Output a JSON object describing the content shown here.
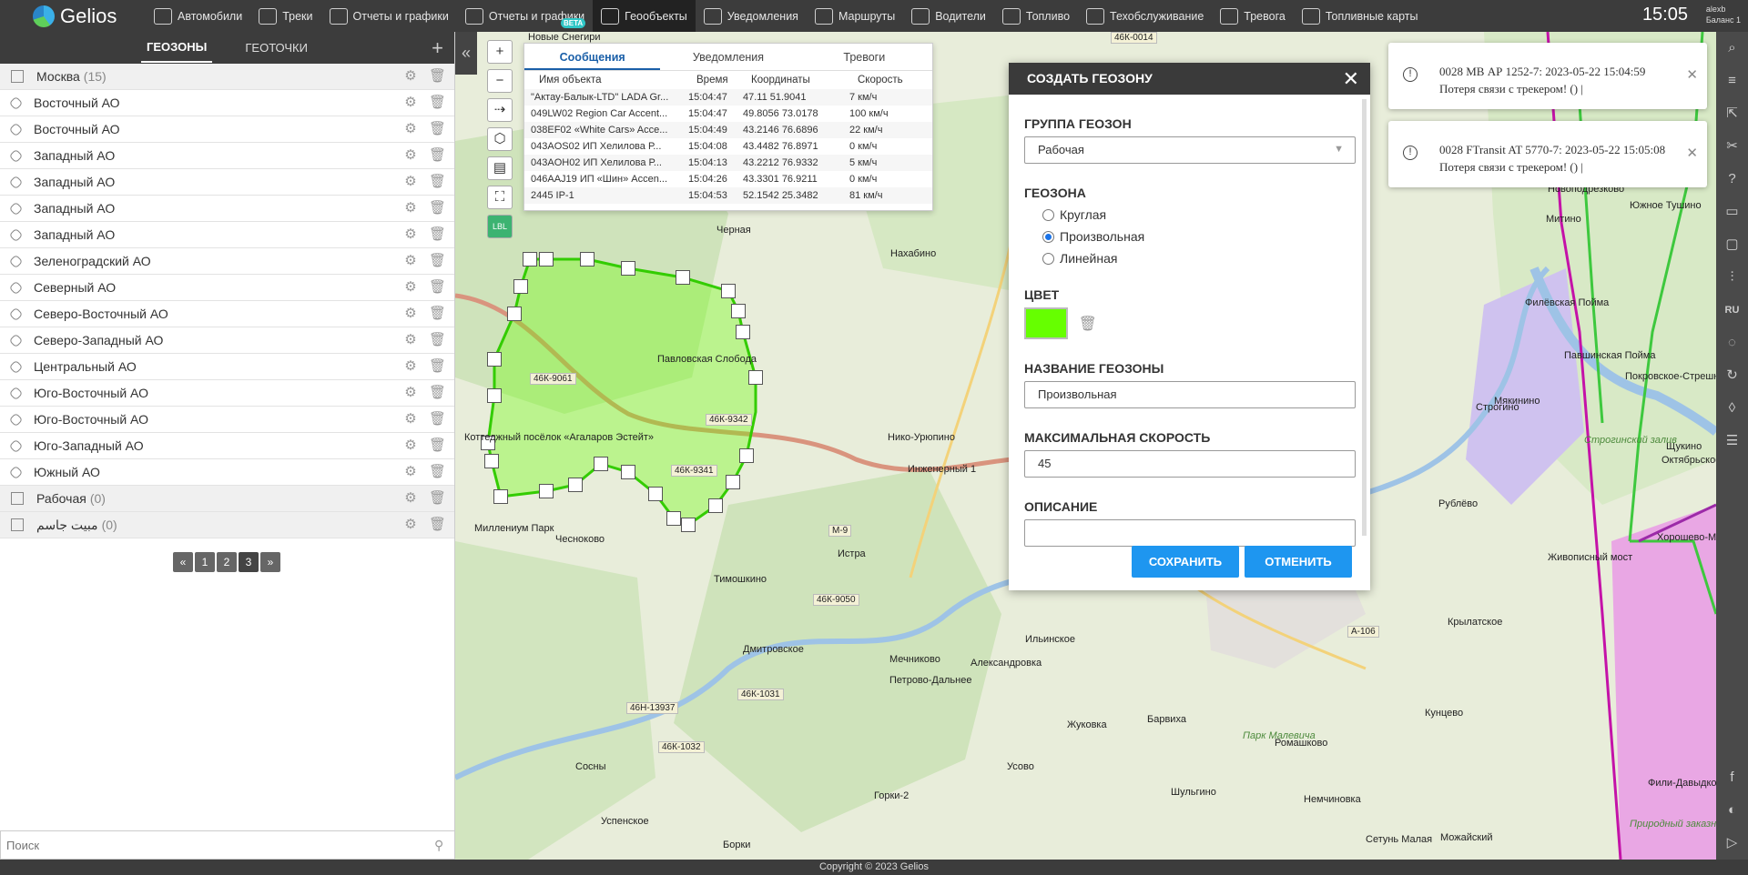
{
  "app": {
    "logo": "Gelios",
    "clock": "15:05",
    "user": "alexb",
    "balance": "Баланс 1",
    "footer": "Copyright © 2023 Gelios"
  },
  "nav": [
    {
      "label": "Автомобили",
      "icon": "car-icon"
    },
    {
      "label": "Треки",
      "icon": "road-icon"
    },
    {
      "label": "Отчеты и графики",
      "icon": "chart-icon"
    },
    {
      "label": "Отчеты и графики",
      "icon": "chart-icon",
      "badge": "BETA"
    },
    {
      "label": "Геообъекты",
      "icon": "geo-pin-icon",
      "active": true
    },
    {
      "label": "Уведомления",
      "icon": "bell-icon"
    },
    {
      "label": "Маршруты",
      "icon": "route-icon"
    },
    {
      "label": "Водители",
      "icon": "driver-icon"
    },
    {
      "label": "Топливо",
      "icon": "fuel-icon"
    },
    {
      "label": "Техобслуживание",
      "icon": "wrench-icon"
    },
    {
      "label": "Тревога",
      "icon": "alarm-icon"
    },
    {
      "label": "Топливные карты",
      "icon": "fuel-card-icon"
    }
  ],
  "left": {
    "tabs": [
      "ГЕОЗОНЫ",
      "ГЕОТОЧКИ"
    ],
    "rows": [
      {
        "name": "Москва",
        "count": "(15)",
        "group": true
      },
      {
        "name": "Восточный АО"
      },
      {
        "name": "Восточный АО"
      },
      {
        "name": "Западный АО"
      },
      {
        "name": "Западный АО"
      },
      {
        "name": "Западный АО"
      },
      {
        "name": "Западный АО"
      },
      {
        "name": "Зеленоградский АО"
      },
      {
        "name": "Северный АО"
      },
      {
        "name": "Северо-Восточный АО"
      },
      {
        "name": "Северо-Западный АО"
      },
      {
        "name": "Центральный АО"
      },
      {
        "name": "Юго-Восточный АО"
      },
      {
        "name": "Юго-Восточный АО"
      },
      {
        "name": "Юго-Западный АО"
      },
      {
        "name": "Южный АО"
      },
      {
        "name": "Рабочая",
        "count": "(0)",
        "group": true
      },
      {
        "name": "مبيت جاسم",
        "count": "(0)",
        "group": true
      }
    ],
    "pager": [
      "«",
      "1",
      "2",
      "3",
      "»"
    ],
    "search_placeholder": "Поиск"
  },
  "messages": {
    "tabs": [
      "Сообщения",
      "Уведомления",
      "Тревоги"
    ],
    "headers": [
      "Имя объекта",
      "Время",
      "Координаты",
      "Скорость"
    ],
    "rows": [
      [
        "\"Актау-Балык-LTD\" LADA Gr...",
        "15:04:47",
        "47.11 51.9041",
        "7 км/ч"
      ],
      [
        "049LW02 Region Car Accent...",
        "15:04:47",
        "49.8056 73.0178",
        "100 км/ч"
      ],
      [
        "038EF02 «White Cars» Acce...",
        "15:04:49",
        "43.2146 76.6896",
        "22 км/ч"
      ],
      [
        "043AOS02 ИП Хелилова Р...",
        "15:04:08",
        "43.4482 76.8971",
        "0 км/ч"
      ],
      [
        "043AOH02 ИП Хелилова Р...",
        "15:04:13",
        "43.2212 76.9332",
        "5 км/ч"
      ],
      [
        "046AAJ19 ИП «Шин» Accen...",
        "15:04:26",
        "43.3301 76.9211",
        "0 км/ч"
      ],
      [
        "2445 IP-1",
        "15:04:53",
        "52.1542 25.3482",
        "81 км/ч"
      ]
    ]
  },
  "dialog": {
    "title": "СОЗДАТЬ ГЕОЗОНУ",
    "group_label": "ГРУППА ГЕОЗОН",
    "group_value": "Рабочая",
    "zone_label": "ГЕОЗОНА",
    "zone_options": [
      "Круглая",
      "Произвольная",
      "Линейная"
    ],
    "zone_selected": "Произвольная",
    "color_label": "ЦВЕТ",
    "color": "#66ff00",
    "name_label": "НАЗВАНИЕ ГЕОЗОНЫ",
    "name_value": "Произвольная",
    "speed_label": "МАКСИМАЛЬНАЯ СКОРОСТЬ",
    "speed_value": "45",
    "desc_label": "ОПИСАНИЕ",
    "desc_value": "",
    "save": "СОХРАНИТЬ",
    "cancel": "ОТМЕНИТЬ"
  },
  "notifications": [
    {
      "text": "0028 МВ АР 1252-7: 2023-05-22 15:04:59 Потеря связи с трекером! () |"
    },
    {
      "text": "0028 FTransit AT 5770-7: 2023-05-22 15:05:08 Потеря связи с трекером! () |"
    }
  ],
  "map_labels": {
    "places": [
      "Нахабино",
      "Павловская Слобода",
      "Тимошкино",
      "Истра",
      "Чесноково",
      "Дмитровское",
      "Мечниково",
      "Петрово-Дальнее",
      "Александровка",
      "Ильинское",
      "Усово",
      "Жуковка",
      "Барвиха",
      "Сосны",
      "Борки",
      "Успенское",
      "Ромашково",
      "Крылатское",
      "Кунцево",
      "Можайский",
      "Строгино",
      "Митино",
      "Покровское-Стрешнево",
      "Южное Тушино",
      "Щукино",
      "Октябрьское Поле",
      "Хорошево-Мнёвники",
      "Филёвская Пойма",
      "Рублёво",
      "Живописный мост",
      "Нико-Урюпино",
      "Черная",
      "Инженерный 1",
      "Миллениум Парк",
      "Горки-2",
      "Шульгино",
      "Немчиновка",
      "Сетунь Малая",
      "Фили-Давыдково",
      "Павшинская Пойма",
      "Мякинино",
      "Новоподрезково",
      "Покровское",
      "Новые Снегири",
      "Коттеджный посёлок «Агаларов Эстейт»"
    ],
    "roads": [
      "46К-9061",
      "46К-9342",
      "46К-9341",
      "М-9",
      "46К-9050",
      "46К-1031",
      "46Н-13937",
      "46К-1032",
      "А-106",
      "46К-0014"
    ],
    "parks": [
      "Парк Малевича",
      "Строгинский залив",
      "Природный заказник"
    ]
  },
  "right_bar": {
    "lang": "RU"
  },
  "colors": {
    "topbar": "#3c3c3c",
    "accent": "#1e96f0",
    "zone": "#66ff00"
  }
}
